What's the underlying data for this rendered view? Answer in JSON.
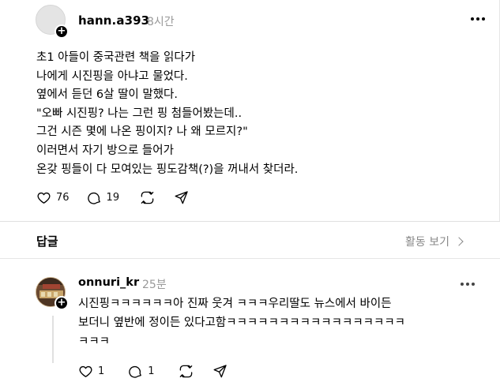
{
  "post": {
    "username": "hann.a393",
    "time": "8시간",
    "avatar_badge": "+",
    "lines": [
      "초1 아들이 중국관련 책을 읽다가",
      "나에게 시진핑을 아냐고 물었다.",
      "옆에서 듣던 6살 딸이 말했다.",
      "\"오빠 시진핑? 나는 그런 핑 첨들어봤는데..",
      "그건 시즌 몇에 나온 핑이지? 나 왜 모르지?\"",
      "이러면서 자기 방으로 들어가",
      "온갖 핑들이 다 모여있는 핑도감책(?)을 꺼내서 찾더라."
    ],
    "likes": "76",
    "comments": "19"
  },
  "replies_section": {
    "title": "답글",
    "activity_label": "활동 보기"
  },
  "reply": {
    "username": "onnuri_kr",
    "time": "25분",
    "avatar_badge": "+",
    "lines": [
      "시진핑ㅋㅋㅋㅋㅋㅋ아 진짜 웃겨 ㅋㅋㅋ우리딸도 뉴스에서 바이든",
      "보더니 옆반에 정이든 있다고함ㅋㅋㅋㅋㅋㅋㅋㅋㅋㅋㅋㅋㅋㅋㅋㅋㅋ",
      "ㅋㅋㅋ"
    ],
    "likes": "1",
    "comments": "1"
  },
  "icons": {
    "like": "heart-icon",
    "comment": "comment-icon",
    "repost": "repost-icon",
    "share": "share-icon",
    "more": "more-icon"
  }
}
